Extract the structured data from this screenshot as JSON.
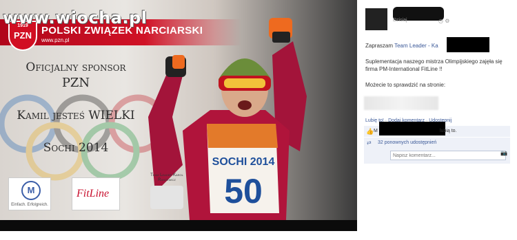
{
  "watermark": "www.wiocha.pl",
  "banner": {
    "logo_year": "1919",
    "logo_text": "PZN",
    "title": "POLSKI ZWIĄZEK NARCIARSKI",
    "url": "www.pzn.pl",
    "sponsor_line1": "Oficjalny sponsor",
    "sponsor_line2": "PZN",
    "kamil_line": "Kamil jesteś WIELKI",
    "sochi_line": "Sochi 2014",
    "dm_text": "Einfach. Erfolgreich.",
    "fitline_text": "FitLine",
    "team_leader_text": "Team Leader Karol Rancewicz",
    "bib_event": "SOCHI 2014",
    "bib_number": "50"
  },
  "post": {
    "meta_prefix": "Dzisiaj",
    "text_prefix": "Zapraszam ",
    "text_link": "Team Leader - Ka",
    "paragraph2": "Suplementacja naszego mistrza Olimpijskiego zajęła się firma PM-International FitLine !!",
    "paragraph3": "Możecie to sprawdzić na stronie:",
    "actions": "Lubię to! · Dodaj komentarz · Udostępnij",
    "likes_prefix": "M",
    "likes_suffix": "lubią to.",
    "shares": "32 ponownych udostępnień",
    "comment_placeholder": "Napisz komentarz..."
  }
}
